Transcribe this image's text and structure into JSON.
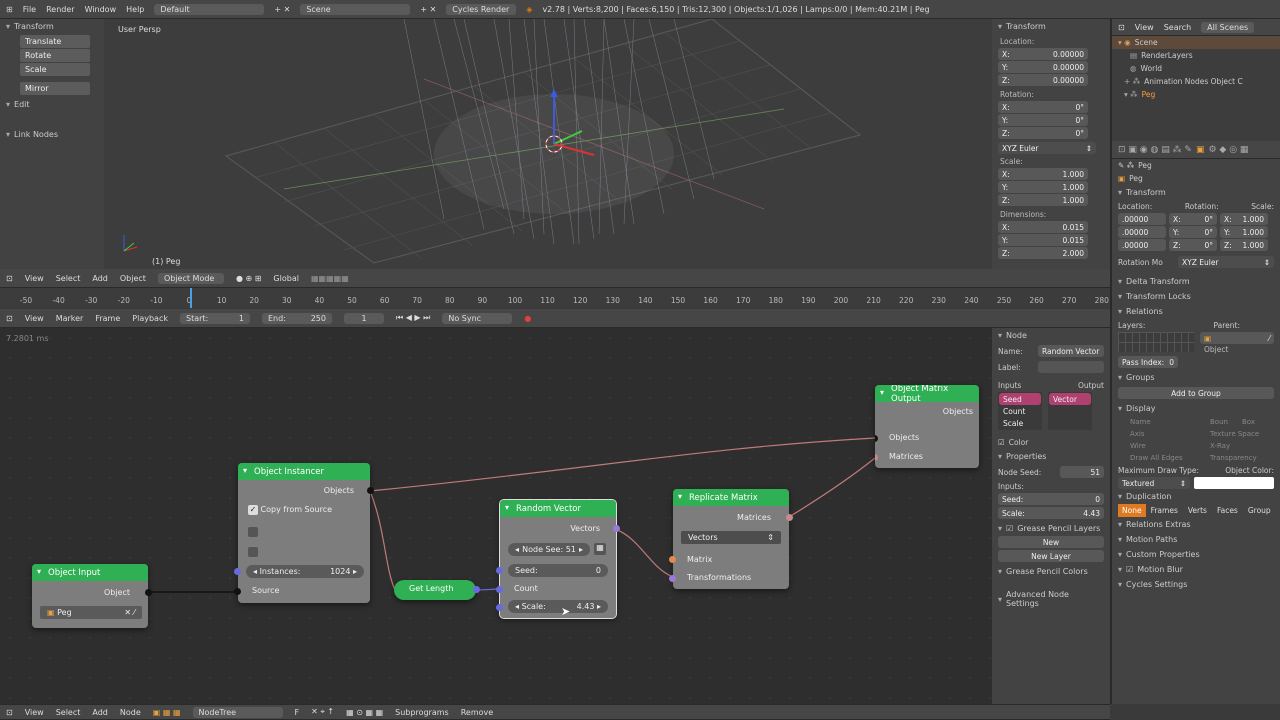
{
  "topbar": {
    "menus": [
      "File",
      "Render",
      "Window",
      "Help"
    ],
    "layout": "Default",
    "scene": "Scene",
    "engine": "Cycles Render",
    "stats": "v2.78 | Verts:8,200 | Faces:6,150 | Tris:12,300 | Objects:1/1,026 | Lamps:0/0 | Mem:40.21M | Peg"
  },
  "toolshelf": {
    "section_transform": "Transform",
    "tools": [
      "Translate",
      "Rotate",
      "Scale",
      "Mirror"
    ],
    "section_edit": "Edit",
    "link_nodes": "Link Nodes"
  },
  "viewport": {
    "view_label": "User Persp",
    "object_label": "(1) Peg",
    "menus": [
      "View",
      "Select",
      "Add",
      "Object"
    ],
    "mode": "Object Mode",
    "orientation": "Global"
  },
  "npanel": {
    "title": "Transform",
    "location_label": "Location:",
    "location": [
      {
        "axis": "X:",
        "value": "0.00000"
      },
      {
        "axis": "Y:",
        "value": "0.00000"
      },
      {
        "axis": "Z:",
        "value": "0.00000"
      }
    ],
    "rotation_label": "Rotation:",
    "rotation": [
      {
        "axis": "X:",
        "value": "0°"
      },
      {
        "axis": "Y:",
        "value": "0°"
      },
      {
        "axis": "Z:",
        "value": "0°"
      }
    ],
    "rotation_mode": "XYZ Euler",
    "scale_label": "Scale:",
    "scale": [
      {
        "axis": "X:",
        "value": "1.000"
      },
      {
        "axis": "Y:",
        "value": "1.000"
      },
      {
        "axis": "Z:",
        "value": "1.000"
      }
    ],
    "dimensions_label": "Dimensions:",
    "dimensions": [
      {
        "axis": "X:",
        "value": "0.015"
      },
      {
        "axis": "Y:",
        "value": "0.015"
      },
      {
        "axis": "Z:",
        "value": "2.000"
      }
    ]
  },
  "timeline": {
    "ticks": [
      "-50",
      "-40",
      "-30",
      "-20",
      "-10",
      "0",
      "10",
      "20",
      "30",
      "40",
      "50",
      "60",
      "70",
      "80",
      "90",
      "100",
      "110",
      "120",
      "130",
      "140",
      "150",
      "160",
      "170",
      "180",
      "190",
      "200",
      "210",
      "220",
      "230",
      "240",
      "250",
      "260",
      "270",
      "280"
    ],
    "menus": [
      "View",
      "Marker",
      "Frame",
      "Playback"
    ],
    "start_label": "Start:",
    "start": "1",
    "end_label": "End:",
    "end": "250",
    "current": "1",
    "sync": "No Sync"
  },
  "node_editor": {
    "timestamp": "7.2801 ms",
    "footer_menus": [
      "View",
      "Select",
      "Add",
      "Node"
    ],
    "tree_name": "NodeTree",
    "footer_flag": "F",
    "subprograms": "Subprograms",
    "remove": "Remove"
  },
  "nodes": {
    "object_input": {
      "title": "Object Input",
      "output": "Object",
      "value": "Peg"
    },
    "object_instancer": {
      "title": "Object Instancer",
      "output": "Objects",
      "checkbox": "Copy from Source",
      "instances_label": "Instances:",
      "instances": "1024",
      "source": "Source"
    },
    "get_length": {
      "title": "Get Length"
    },
    "random_vector": {
      "title": "Random Vector",
      "output": "Vectors",
      "node_seed": "Node See: 51",
      "seed_label": "Seed:",
      "seed": "0",
      "count": "Count",
      "scale_label": "Scale:",
      "scale": "4.43"
    },
    "replicate_matrix": {
      "title": "Replicate Matrix",
      "output": "Matrices",
      "mode": "Vectors",
      "in_matrix": "Matrix",
      "in_transforms": "Transformations"
    },
    "object_matrix_output": {
      "title": "Object Matrix Output",
      "output": "Objects",
      "in_objects": "Objects",
      "in_matrices": "Matrices"
    }
  },
  "node_sidebar": {
    "node_title": "Node",
    "name_label": "Name:",
    "name": "Random Vector",
    "label_label": "Label:",
    "inputs_label": "Inputs",
    "output_label": "Output",
    "inputs": [
      "Seed",
      "Count",
      "Scale"
    ],
    "outputs": [
      "Vector"
    ],
    "color": "Color",
    "properties": "Properties",
    "node_seed_label": "Node Seed:",
    "node_seed": "51",
    "inputs2": "Inputs:",
    "seed_label": "Seed:",
    "seed": "0",
    "scale_label": "Scale:",
    "scale": "4.43",
    "gp_layers": "Grease Pencil Layers",
    "gp_new": "New",
    "gp_new_layer": "New Layer",
    "gp_colors": "Grease Pencil Colors",
    "advanced": "Advanced Node Settings"
  },
  "outliner": {
    "menus": [
      "View",
      "Search",
      "All Scenes"
    ],
    "items": [
      "Scene",
      "RenderLayers",
      "World",
      "Animation Nodes Object C",
      "Peg"
    ]
  },
  "properties": {
    "object_path": "Peg",
    "object_name": "Peg",
    "transform": "Transform",
    "location_label": "Location:",
    "rotation_label": "Rotation:",
    "scale_label": "Scale:",
    "loc": [
      ".00000",
      ".00000",
      ".00000"
    ],
    "rot": [
      {
        "a": "X:",
        "v": "0°"
      },
      {
        "a": "Y:",
        "v": "0°"
      },
      {
        "a": "Z:",
        "v": "0°"
      }
    ],
    "scl": [
      {
        "a": "X:",
        "v": "1.000"
      },
      {
        "a": "Y:",
        "v": "1.000"
      },
      {
        "a": "Z:",
        "v": "1.000"
      }
    ],
    "rotation_mode_label": "Rotation Mo",
    "rotation_mode": "XYZ Euler",
    "delta": "Delta Transform",
    "locks": "Transform Locks",
    "relations": "Relations",
    "layers_label": "Layers:",
    "parent_label": "Parent:",
    "parent_value": "Object",
    "pass_index_label": "Pass Index:",
    "pass_index": "0",
    "groups": "Groups",
    "add_to_group": "Add to Group",
    "display": "Display",
    "disp_left": [
      "Name",
      "Axis",
      "Wire",
      "Draw All Edges"
    ],
    "disp_right": [
      "Boun",
      "Box",
      "Texture Space",
      "X-Ray",
      "Transparency"
    ],
    "max_draw_label": "Maximum Draw Type:",
    "object_color_label": "Object Color:",
    "max_draw": "Textured",
    "duplication": "Duplication",
    "dup_modes": [
      "None",
      "Frames",
      "Verts",
      "Faces",
      "Group"
    ],
    "rel_extras": "Relations Extras",
    "motion_paths": "Motion Paths",
    "custom_props": "Custom Properties",
    "motion_blur": "Motion Blur",
    "cycles": "Cycles Settings"
  },
  "colors": {
    "node_header": "#2fb054",
    "link": "#c07a7a",
    "selection": "#ff9a3a"
  }
}
